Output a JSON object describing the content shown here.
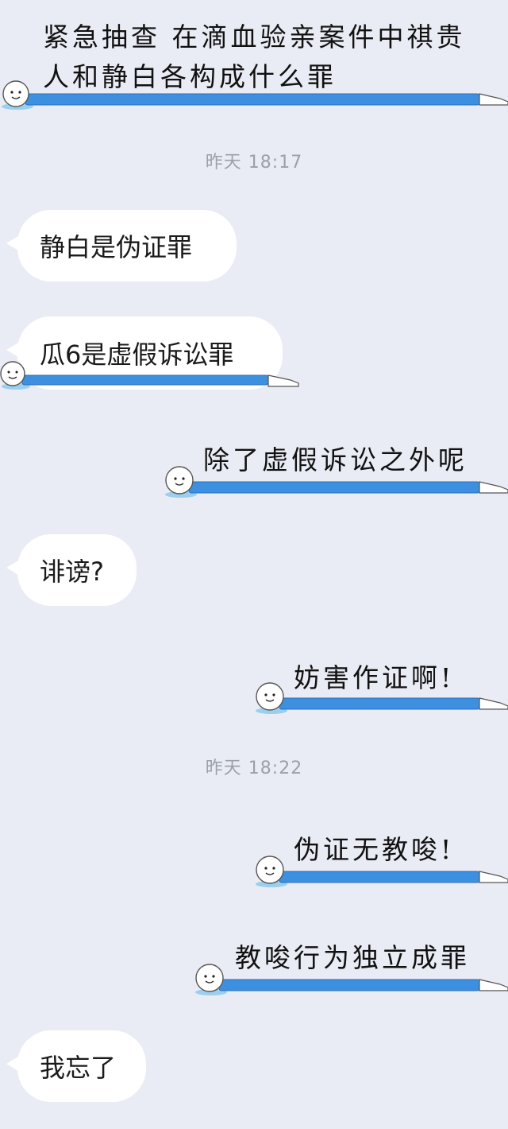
{
  "messages": {
    "m1_line1": "紧急抽查 在滴血验亲案件中祺贵",
    "m1_line2": "人和静白各构成什么罪",
    "ts1": "昨天 18:17",
    "m2": "静白是伪证罪",
    "m3": "瓜6是虚假诉讼罪",
    "m4": "除了虚假诉讼之外呢",
    "m5": "诽谤?",
    "m6": "妨害作证啊!",
    "ts2": "昨天 18:22",
    "m7": "伪证无教唆!",
    "m8": "教唆行为独立成罪",
    "m9": "我忘了"
  },
  "colors": {
    "background": "#e9ecf5",
    "bubble": "#ffffff",
    "body_blue": "#3d8fe0",
    "timestamp": "#9aa0aa"
  },
  "icons": {
    "lying_figure": "lying-doll-icon"
  }
}
